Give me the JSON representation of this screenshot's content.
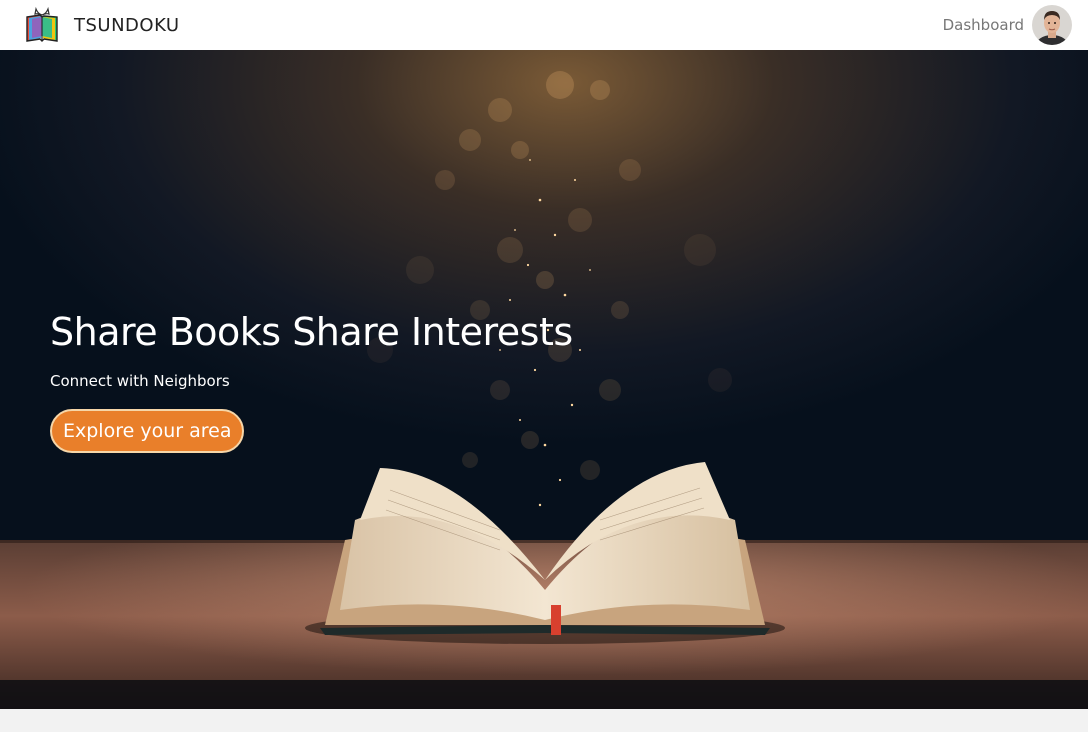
{
  "nav": {
    "brand_name": "TSUNDOKU",
    "brand_logo_icon": "books-gift-logo-icon",
    "dashboard_label": "Dashboard",
    "avatar_icon": "user-avatar"
  },
  "hero": {
    "title": "Share Books Share Interests",
    "subtitle": "Connect with Neighbors",
    "cta_label": "Explore your area",
    "background": "open-book-on-table-with-bokeh-photo"
  },
  "colors": {
    "accent": "#e97f2a",
    "accent_border": "#f6d6a8",
    "hero_text": "#ffffff",
    "nav_bg": "#ffffff",
    "page_bg": "#f2f2f2"
  }
}
